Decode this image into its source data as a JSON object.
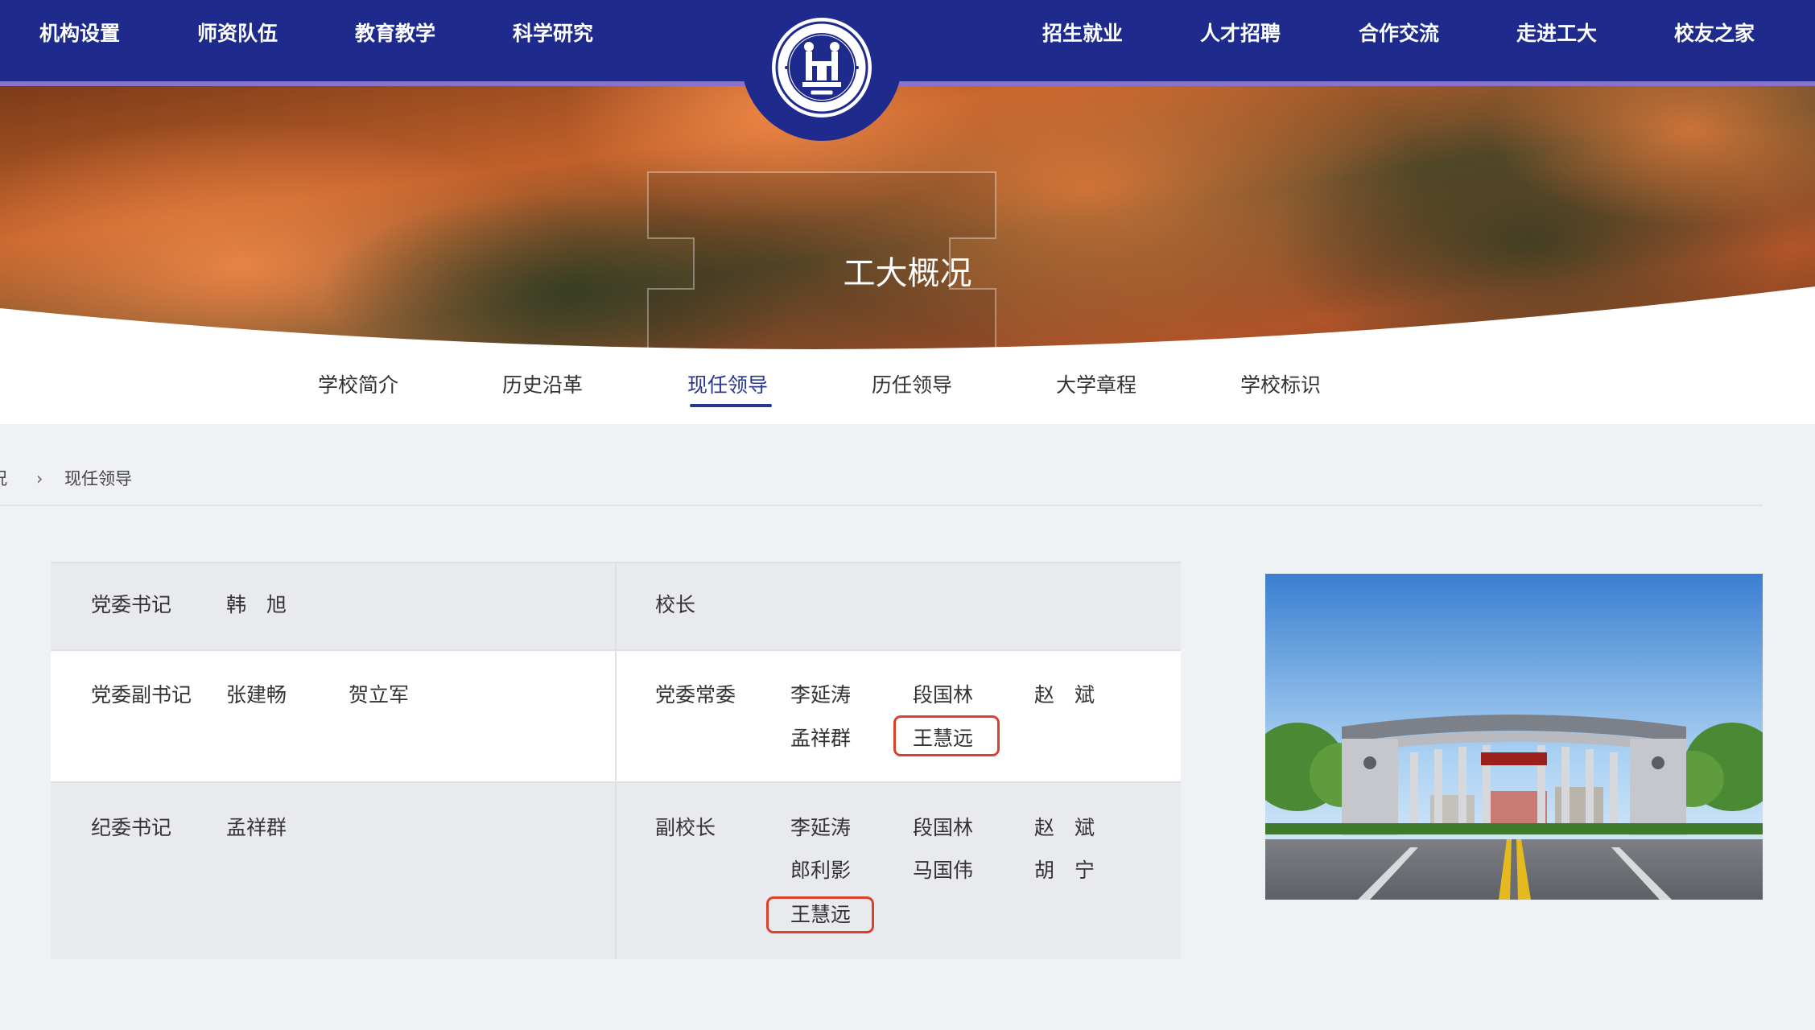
{
  "top_nav": {
    "left_items": [
      "机构设置",
      "师资队伍",
      "教育教学",
      "科学研究"
    ],
    "right_items": [
      "招生就业",
      "人才招聘",
      "合作交流",
      "走进工大",
      "校友之家"
    ]
  },
  "logo": {
    "icon": "university-seal-icon"
  },
  "banner": {
    "title": "工大概况"
  },
  "sub_nav": {
    "items": [
      "学校简介",
      "历史沿革",
      "现任领导",
      "历任领导",
      "大学章程",
      "学校标识"
    ],
    "active": "现任领导"
  },
  "breadcrumb": {
    "parent": "况",
    "separator": "›",
    "current": "现任领导"
  },
  "leaders": {
    "row1": {
      "left_title": "党委书记",
      "left_names": [
        "韩　旭"
      ],
      "right_title": "校长",
      "right_names": []
    },
    "row2": {
      "left_title": "党委副书记",
      "left_names": [
        "张建畅",
        "贺立军"
      ],
      "right_title": "党委常委",
      "right_names": [
        "李延涛",
        "段国林",
        "赵　斌",
        "孟祥群",
        "王慧远"
      ]
    },
    "row3": {
      "left_title": "纪委书记",
      "left_names": [
        "孟祥群"
      ],
      "right_title": "副校长",
      "right_names": [
        "李延涛",
        "段国林",
        "赵　斌",
        "郎利影",
        "马国伟",
        "胡　宁",
        "王慧远"
      ]
    },
    "highlight_color": "#d9412b"
  },
  "colors": {
    "nav_bg": "#1e2a8c",
    "accent_line": "#8b72c9",
    "active": "#2a3590"
  }
}
